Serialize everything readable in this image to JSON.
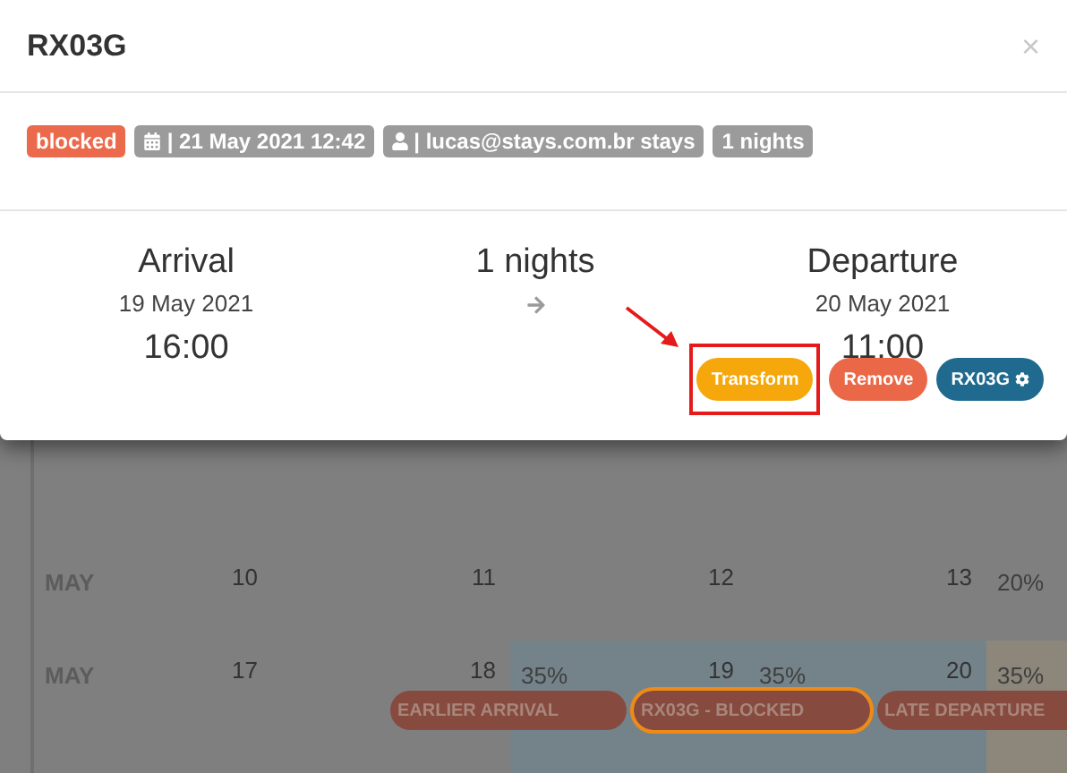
{
  "modal": {
    "title": "RX03G",
    "close": "×",
    "badges": [
      {
        "kind": "status",
        "text": "blocked"
      },
      {
        "kind": "date",
        "text": "| 21 May 2021 12:42"
      },
      {
        "kind": "user",
        "text": "| lucas@stays.com.br stays"
      },
      {
        "kind": "plain",
        "text": "1 nights"
      }
    ],
    "arrival": {
      "label": "Arrival",
      "date": "19 May 2021",
      "time": "16:00"
    },
    "stay": {
      "label": "1 nights"
    },
    "departure": {
      "label": "Departure",
      "date": "20 May 2021",
      "time": "11:00"
    },
    "buttons": [
      {
        "kind": "transform",
        "label": "Transform",
        "highlighted": true
      },
      {
        "kind": "remove",
        "label": "Remove",
        "highlighted": false
      },
      {
        "kind": "listing",
        "label": "RX03G",
        "highlighted": false
      }
    ]
  },
  "calendar": {
    "weeks": [
      {
        "month": "MAY",
        "days": [
          {
            "day": "10"
          },
          {
            "day": "11"
          },
          {
            "day": "12"
          },
          {
            "day": "13"
          },
          {
            "rate": "20%"
          }
        ]
      },
      {
        "month": "MAY",
        "days": [
          {
            "day": "17"
          },
          {
            "day": "18"
          },
          {
            "day": "19",
            "rate": "35%",
            "color": "#74838a"
          },
          {
            "day": "20",
            "rate": "35%",
            "color": "#74838a"
          },
          {
            "rate": "35%",
            "color": "#8c877a"
          }
        ],
        "events": [
          {
            "label": "EARLIER ARRIVAL",
            "selected": false
          },
          {
            "label": "RX03G - BLOCKED",
            "selected": true
          },
          {
            "label": "LATE DEPARTURE",
            "selected": false
          }
        ]
      }
    ]
  }
}
